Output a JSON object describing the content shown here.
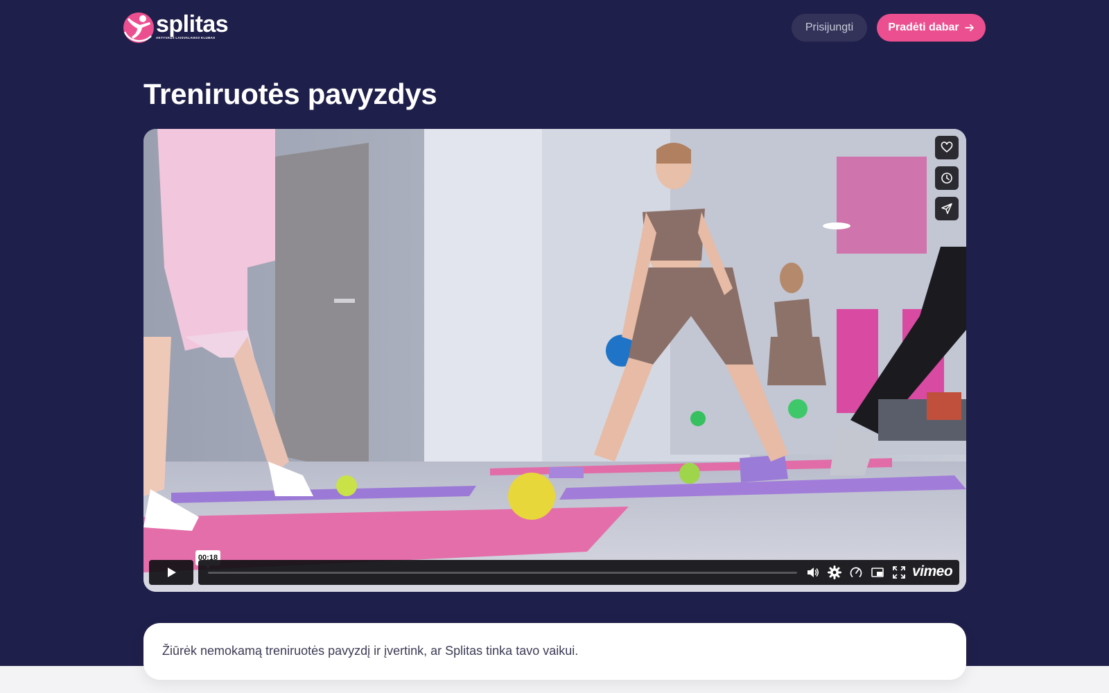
{
  "brand": {
    "name": "splitas",
    "tagline": "AKTYVAUS LAISVALAIKIO KLUBAS",
    "accent_color": "#ec4f8f",
    "background_color": "#1f1f4b"
  },
  "header": {
    "login_label": "Prisijungti",
    "start_label": "Pradėti dabar",
    "start_icon": "arrow-right-icon"
  },
  "main": {
    "title": "Treniruotės pavyzdys",
    "description": "Žiūrėk nemokamą treniruotės pavyzdį ir įvertink, ar Splitas tinka tavo vaikui."
  },
  "video": {
    "current_time": "00:18",
    "progress": 0.0,
    "provider": "vimeo",
    "side_actions": [
      "heart-icon",
      "clock-icon",
      "send-icon"
    ],
    "controls": [
      "volume-icon",
      "settings-icon",
      "speed-icon",
      "pip-icon",
      "fullscreen-icon"
    ]
  }
}
